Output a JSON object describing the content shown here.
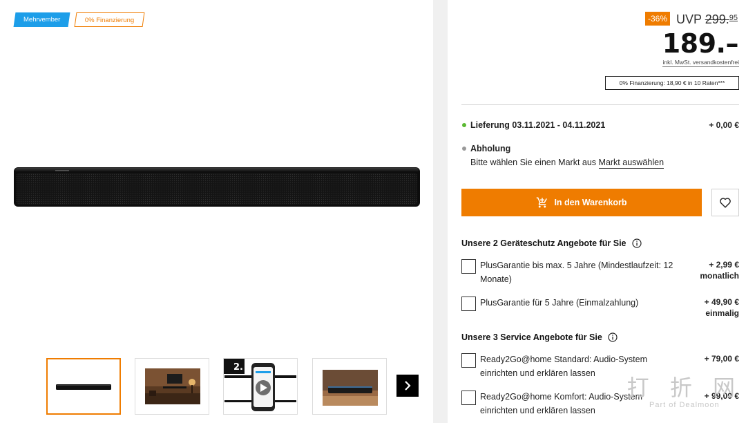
{
  "badges": {
    "promo": "Mehrvember",
    "financing": "0% Finanzierung"
  },
  "pricing": {
    "discount": "-36%",
    "uvp_label": "UVP",
    "uvp_main": "299.",
    "uvp_cents": "95",
    "price": "189.–",
    "vat_note": "inkl. MwSt. versandkostenfrei",
    "financing": "0% Finanzierung: 18,90 € in 10 Raten***"
  },
  "delivery": {
    "label": "Lieferung 03.11.2021 - 04.11.2021",
    "price": "+ 0,00 €",
    "status_color": "#5bb932"
  },
  "pickup": {
    "label": "Abholung",
    "text": "Bitte wählen Sie einen Markt aus",
    "link": "Markt auswählen"
  },
  "cart_button": "In den Warenkorb",
  "protection": {
    "title": "Unsere 2 Geräteschutz Angebote für Sie",
    "options": [
      {
        "text": "PlusGarantie bis max. 5 Jahre (Mindestlaufzeit: 12 Monate)",
        "price": "+ 2,99 €",
        "period": "monatlich"
      },
      {
        "text": "PlusGarantie für 5 Jahre (Einmalzahlung)",
        "price": "+ 49,90 €",
        "period": "einmalig"
      }
    ]
  },
  "service": {
    "title": "Unsere 3 Service Angebote für Sie",
    "options": [
      {
        "text": "Ready2Go@home Standard: Audio-System einrichten und erklären lassen",
        "price": "+ 79,00 €"
      },
      {
        "text": "Ready2Go@home Komfort: Audio-System einrichten und erklären lassen",
        "price": "+ 99,00 €"
      }
    ]
  },
  "thumbnails": {
    "video_badge": "2."
  },
  "watermark": {
    "big": "打 折 网",
    "small": "Part of Dealmoon"
  },
  "colors": {
    "accent": "#ef7c00",
    "badge_blue": "#1d9ee9",
    "divider": "#f0f0f0"
  }
}
